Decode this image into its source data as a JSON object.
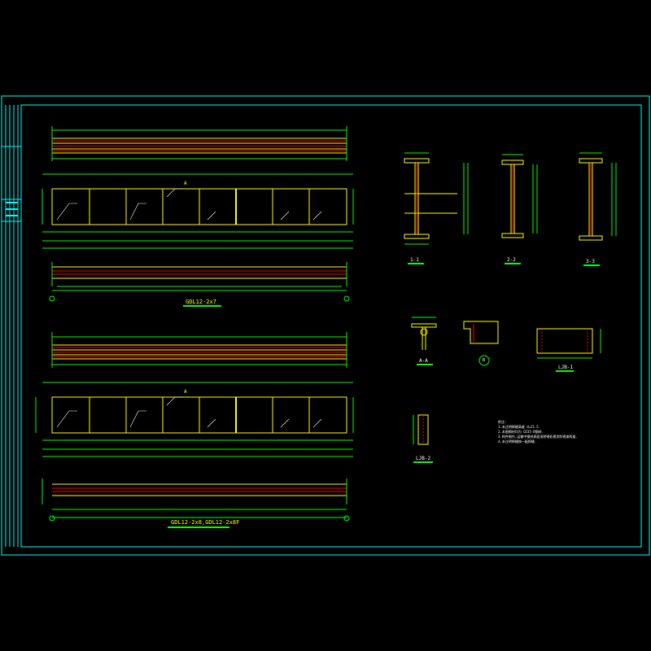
{
  "titles": {
    "beam_top": "GDL12-2x7",
    "beam_bottom": "GDL12-2x8,GDL12-2x8F",
    "sec_1": "1-1",
    "sec_2": "2-2",
    "sec_3": "3-3",
    "sec_a": "A-A",
    "sec_b": "B",
    "ljb1": "LJB-1",
    "ljb2": "LJB-2"
  },
  "marks": {
    "a_top": "A",
    "a_bottom": "A"
  },
  "notes": {
    "heading": "附注:",
    "lines": [
      "1.未注明焊缝高度 d=21.5.",
      "2.本图钢材均为 Q235-B钢材.",
      "3.构件制作,运输中钢材表面须除锈处理涂防锈漆两道.",
      "4.未注明焊缝按一级焊缝."
    ]
  },
  "colors": {
    "background": "#000000",
    "frame": "#00ffff",
    "beam_outline": "#ffff00",
    "rebar": "#ff0000",
    "dimension": "#00ff00",
    "text": "#ffffff",
    "stiffener": "#ff00ff"
  }
}
